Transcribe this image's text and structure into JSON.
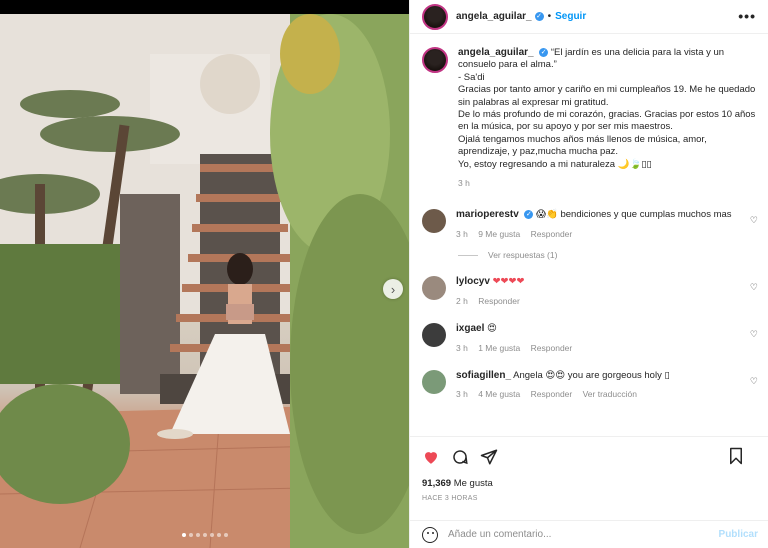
{
  "header": {
    "username": "angela_aguilar_",
    "verified_mark": "✓",
    "separator": "•",
    "follow_label": "Seguir",
    "more_label": "•••"
  },
  "caption": {
    "username": "angela_aguilar_",
    "lines": [
      "“El jardín es una delicia para la vista y un consuelo para el alma.”",
      "- Sa'di",
      "Gracias por tanto amor y cariño en mi cumpleaños 19. Me he quedado sin palabras al expresar mi gratitud.",
      "De lo más profundo de mi corazón, gracias. Gracias por estos 10 años en la música, por su apoyo y por ser mis maestros.",
      "Ojalá tengamos muchos años más llenos de música, amor, aprendizaje, y paz,mucha mucha paz.",
      "Yo, estoy regresando a mi naturaleza 🌙🍃▯▯"
    ],
    "time": "3 h"
  },
  "comments": [
    {
      "username": "marioperestv",
      "text": "😱👏 bendiciones y que cumplas muchos mas",
      "time": "3 h",
      "likes": "9 Me gusta",
      "reply": "Responder",
      "view_replies": "Ver respuestas (1)"
    },
    {
      "username": "lylocyv",
      "text": "❤❤❤❤",
      "time": "2 h",
      "reply": "Responder"
    },
    {
      "username": "ixgael",
      "text": "😍",
      "time": "3 h",
      "likes": "1 Me gusta",
      "reply": "Responder"
    },
    {
      "username": "sofiagillen_",
      "text": "Angela 😍😍 you are gorgeous holy ▯",
      "time": "3 h",
      "likes": "4 Me gusta",
      "reply": "Responder",
      "translate": "Ver traducción"
    }
  ],
  "post": {
    "likes_count": "91,369",
    "likes_label": "Me gusta",
    "time_ago": "HACE 3 HORAS"
  },
  "add_comment": {
    "placeholder": "Añade un comentario...",
    "publish_label": "Publicar"
  },
  "carousel": {
    "slides": 7,
    "current": 1
  },
  "colors": {
    "accent": "#0095f6",
    "like_red": "#ed4956",
    "verified_blue": "#3897f0",
    "publish_disabled": "#b2dffc"
  },
  "icons": [
    "heart-icon",
    "comment-icon",
    "share-icon",
    "bookmark-icon",
    "emoji-icon",
    "next-arrow-icon",
    "more-icon",
    "verified-icon"
  ]
}
